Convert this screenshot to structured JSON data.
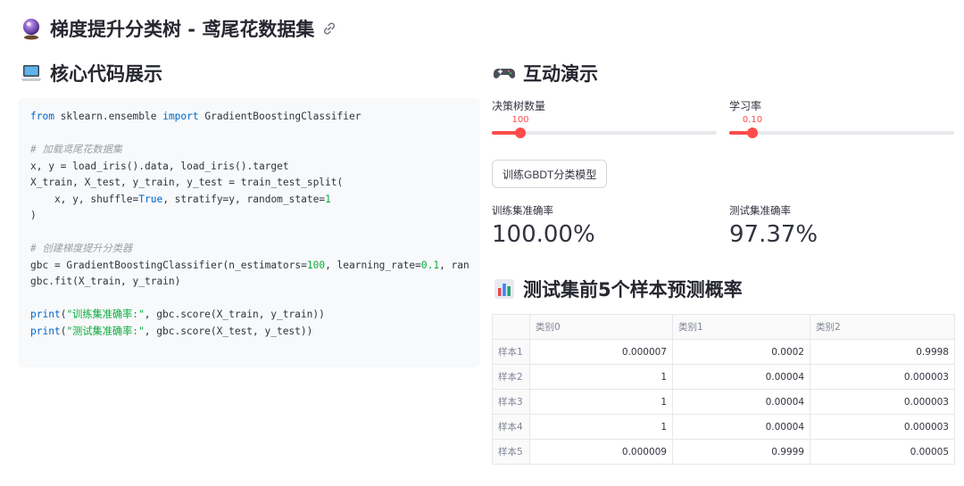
{
  "page": {
    "title": "梯度提升分类树 - 鸢尾花数据集",
    "title_icon": "crystal-ball-icon",
    "link_icon": "link-icon"
  },
  "code_section": {
    "heading": "核心代码展示",
    "icon": "laptop-icon",
    "lines": [
      "from sklearn.ensemble import GradientBoostingClassifier",
      "",
      "# 加载鸢尾花数据集",
      "x, y = load_iris().data, load_iris().target",
      "X_train, X_test, y_train, y_test = train_test_split(",
      "    x, y, shuffle=True, stratify=y, random_state=1",
      ")",
      "",
      "# 创建梯度提升分类器",
      "gbc = GradientBoostingClassifier(n_estimators=100, learning_rate=0.1, ran",
      "gbc.fit(X_train, y_train)",
      "",
      "print(\"训练集准确率:\", gbc.score(X_train, y_train))",
      "print(\"测试集准确率:\", gbc.score(X_test, y_test))"
    ]
  },
  "demo_section": {
    "heading": "互动演示",
    "icon": "game-controller-icon",
    "slider_trees": {
      "label": "决策树数量",
      "value": "100",
      "fraction": 0.128
    },
    "slider_lr": {
      "label": "学习率",
      "value": "0.10",
      "fraction": 0.105
    },
    "train_button": "训练GBDT分类模型",
    "metric_train": {
      "label": "训练集准确率",
      "value": "100.00%"
    },
    "metric_test": {
      "label": "测试集准确率",
      "value": "97.37%"
    },
    "accent_color": "#ff4b4b"
  },
  "table_section": {
    "heading": "测试集前5个样本预测概率",
    "icon": "bar-chart-icon",
    "columns": [
      "",
      "类别0",
      "类别1",
      "类别2"
    ],
    "rows": [
      [
        "样本1",
        "0.000007",
        "0.0002",
        "0.9998"
      ],
      [
        "样本2",
        "1",
        "0.00004",
        "0.000003"
      ],
      [
        "样本3",
        "1",
        "0.00004",
        "0.000003"
      ],
      [
        "样本4",
        "1",
        "0.00004",
        "0.000003"
      ],
      [
        "样本5",
        "0.000009",
        "0.9999",
        "0.00005"
      ]
    ]
  }
}
